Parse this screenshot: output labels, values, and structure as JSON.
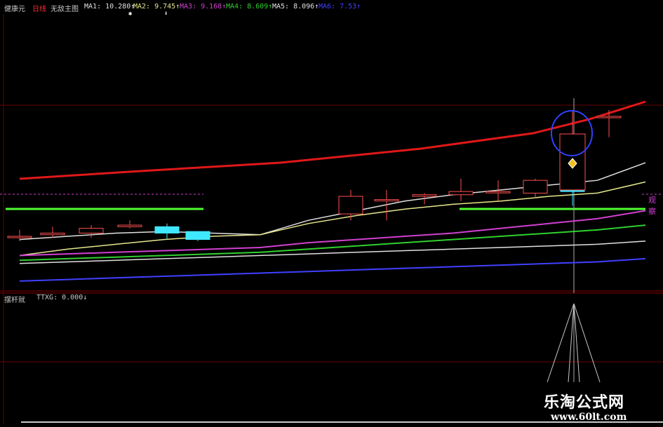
{
  "header": {
    "stock": "健康元",
    "period": "日线",
    "chart_name": "无敌主图",
    "ma1": "MA1: 10.280↑",
    "ma2": "MA2: 9.745↑",
    "ma3": "MA3: 9.168↑",
    "ma4": "MA4: 8.609↑",
    "ma5": "MA5: 8.096↑",
    "ma6": "MA6: 7.53↑"
  },
  "colors": {
    "stock": "#c8c8c8",
    "period": "#ff3030",
    "chart_name": "#c8c8c8",
    "ma1": "#e0e0e0",
    "ma2": "#e6e68c",
    "ma3": "#d040d0",
    "ma4": "#30d030",
    "ma5": "#e0e0e0",
    "ma6": "#4040ff",
    "up": "#ff5050",
    "down": "#40e8ff"
  },
  "right_label": "观察",
  "sub_panel": {
    "name": "摆杆就",
    "indicator": "TTXG: 0.000↓"
  },
  "watermark": {
    "title": "乐淘公式网",
    "url": "www.60lt.com"
  },
  "chart_data": {
    "type": "candlestick",
    "candles": [
      {
        "o": 9.5,
        "h": 9.54,
        "l": 9.47,
        "c": 9.5
      },
      {
        "o": 9.51,
        "h": 9.56,
        "l": 9.49,
        "c": 9.52
      },
      {
        "o": 9.52,
        "h": 9.57,
        "l": 9.49,
        "c": 9.55
      },
      {
        "o": 9.56,
        "h": 9.6,
        "l": 9.55,
        "c": 9.57
      },
      {
        "o": 9.56,
        "h": 9.58,
        "l": 9.48,
        "c": 9.52
      },
      {
        "o": 9.53,
        "h": 9.53,
        "l": 9.47,
        "c": 9.48
      },
      {
        "o": 9.64,
        "h": 9.79,
        "l": 9.6,
        "c": 9.75
      },
      {
        "o": 9.73,
        "h": 9.79,
        "l": 9.6,
        "c": 9.73
      },
      {
        "o": 9.75,
        "h": 9.77,
        "l": 9.7,
        "c": 9.76
      },
      {
        "o": 9.76,
        "h": 9.86,
        "l": 9.72,
        "c": 9.78
      },
      {
        "o": 9.78,
        "h": 9.85,
        "l": 9.72,
        "c": 9.78
      },
      {
        "o": 9.77,
        "h": 9.86,
        "l": 9.74,
        "c": 9.85
      },
      {
        "o": 9.84,
        "h": 9.84,
        "l": 9.69,
        "c": 9.78
      },
      {
        "o": 9.79,
        "h": 10.29,
        "l": 9.79,
        "c": 10.14
      },
      {
        "o": 10.25,
        "h": 10.29,
        "l": 10.12,
        "c": 10.25
      }
    ],
    "ma_series": [
      {
        "name": "MA1",
        "values": [
          9.48,
          9.5,
          9.52,
          9.53,
          9.52,
          9.51,
          9.6,
          9.66,
          9.72,
          9.76,
          9.79,
          9.82,
          9.85,
          9.96,
          10.28
        ]
      },
      {
        "name": "MA2",
        "values": [
          9.38,
          9.42,
          9.45,
          9.48,
          9.5,
          9.51,
          9.58,
          9.63,
          9.67,
          9.7,
          9.72,
          9.75,
          9.77,
          9.84,
          9.745
        ]
      },
      {
        "name": "MA3",
        "values": [
          9.38,
          9.39,
          9.4,
          9.41,
          9.42,
          9.43,
          9.46,
          9.48,
          9.5,
          9.52,
          9.55,
          9.58,
          9.61,
          9.66,
          9.168
        ]
      },
      {
        "name": "MA4",
        "values": [
          9.35,
          9.36,
          9.37,
          9.38,
          9.39,
          9.4,
          9.42,
          9.44,
          9.46,
          9.48,
          9.5,
          9.52,
          9.54,
          9.57,
          8.609
        ]
      },
      {
        "name": "MA5",
        "values": [
          9.33,
          9.34,
          9.35,
          9.36,
          9.37,
          9.38,
          9.39,
          9.4,
          9.41,
          9.42,
          9.43,
          9.44,
          9.45,
          9.47,
          8.096
        ]
      },
      {
        "name": "MA6",
        "values": [
          9.22,
          9.23,
          9.24,
          9.25,
          9.26,
          9.27,
          9.28,
          9.29,
          9.3,
          9.31,
          9.32,
          9.33,
          9.34,
          9.36,
          7.53
        ]
      }
    ],
    "ylim": [
      9.18,
      10.32
    ]
  }
}
